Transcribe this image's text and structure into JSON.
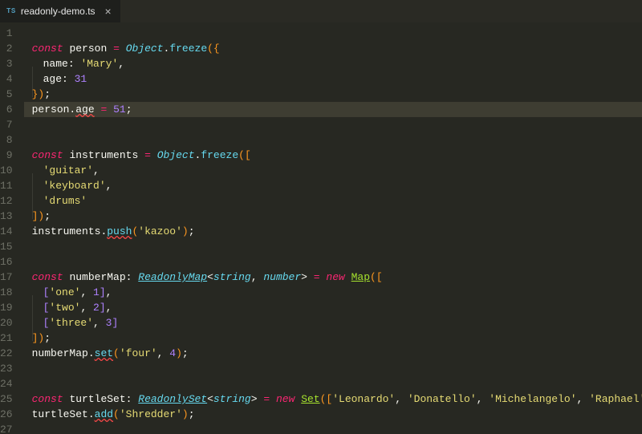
{
  "tab": {
    "icon_label": "TS",
    "filename": "readonly-demo.ts",
    "close_glyph": "×"
  },
  "editor": {
    "highlighted_line": 6,
    "line_count": 27
  },
  "code": {
    "l2": {
      "kw": "const",
      "var": "person",
      "eq": "=",
      "cls": "Object",
      "fn": "freeze",
      "br_open": "({"
    },
    "l3": {
      "key": "name",
      "val": "'Mary'"
    },
    "l4": {
      "key": "age",
      "val": "31"
    },
    "l5": {
      "br_close": "})",
      "semi": ";"
    },
    "l6": {
      "obj": "person",
      "prop": "age",
      "eq": "=",
      "val": "51",
      "semi": ";"
    },
    "l9": {
      "kw": "const",
      "var": "instruments",
      "eq": "=",
      "cls": "Object",
      "fn": "freeze",
      "br_open": "(["
    },
    "l10": {
      "val": "'guitar'"
    },
    "l11": {
      "val": "'keyboard'"
    },
    "l12": {
      "val": "'drums'"
    },
    "l13": {
      "br_close": "])",
      "semi": ";"
    },
    "l14": {
      "obj": "instruments",
      "fn": "push",
      "arg": "'kazoo'",
      "semi": ";"
    },
    "l17": {
      "kw": "const",
      "var": "numberMap",
      "colon": ":",
      "type": "ReadonlyMap",
      "g1": "string",
      "g2": "number",
      "eq": "=",
      "new": "new",
      "ctor": "Map",
      "br_open": "(["
    },
    "l18": {
      "k": "'one'",
      "v": "1"
    },
    "l19": {
      "k": "'two'",
      "v": "2"
    },
    "l20": {
      "k": "'three'",
      "v": "3"
    },
    "l21": {
      "br_close": "])",
      "semi": ";"
    },
    "l22": {
      "obj": "numberMap",
      "fn": "set",
      "arg1": "'four'",
      "arg2": "4",
      "semi": ";"
    },
    "l25": {
      "kw": "const",
      "var": "turtleSet",
      "colon": ":",
      "type": "ReadonlySet",
      "g1": "string",
      "eq": "=",
      "new": "new",
      "ctor": "Set",
      "a1": "'Leonardo'",
      "a2": "'Donatello'",
      "a3": "'Michelangelo'",
      "a4": "'Raphael'",
      "semi": ";"
    },
    "l26": {
      "obj": "turtleSet",
      "fn": "add",
      "arg": "'Shredder'",
      "semi": ";"
    }
  }
}
